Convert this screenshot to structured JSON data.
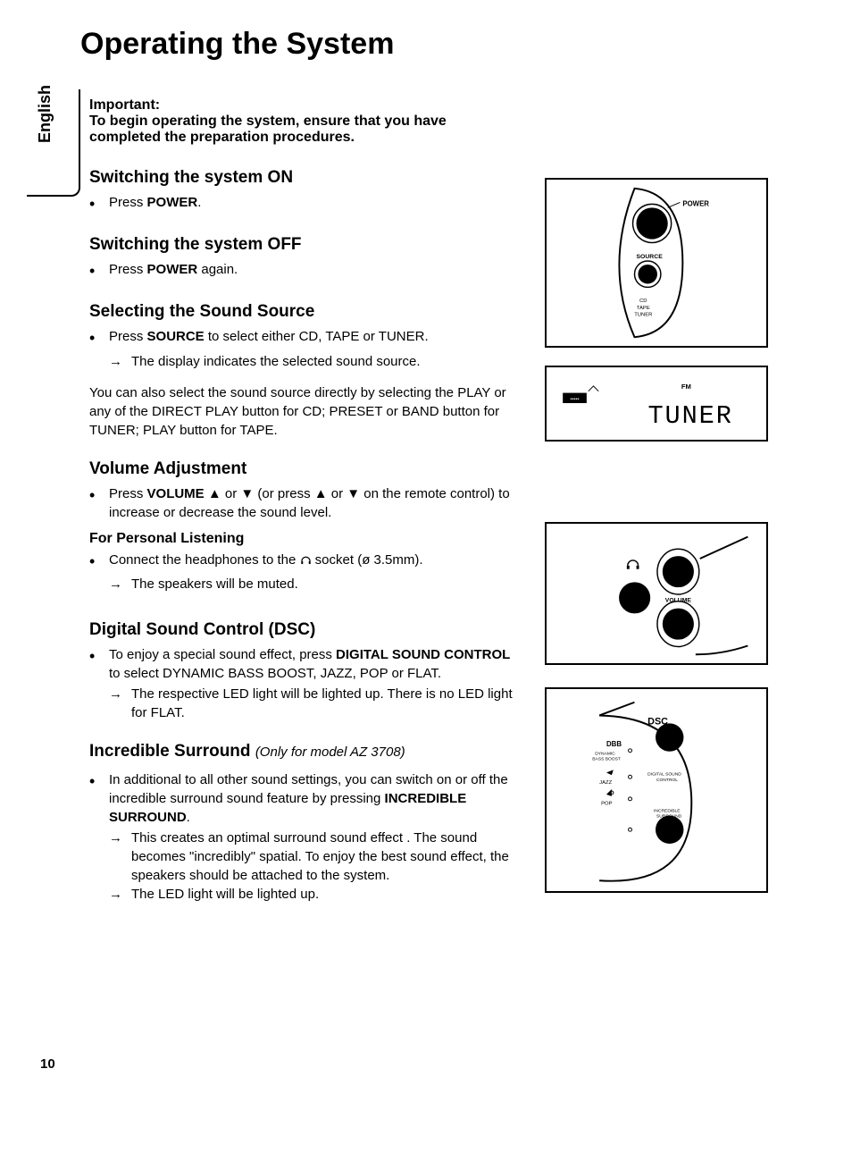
{
  "page_title": "Operating the System",
  "language_tab": "English",
  "intro": {
    "label": "Important:",
    "body": "To begin operating the system, ensure that you have completed the preparation procedures."
  },
  "sections": {
    "switch_on": {
      "heading": "Switching the system ON",
      "bullet1_pre": "Press ",
      "bullet1_bold": "POWER",
      "bullet1_post": "."
    },
    "switch_off": {
      "heading": "Switching the system OFF",
      "bullet1_pre": "Press ",
      "bullet1_bold": "POWER",
      "bullet1_post": " again."
    },
    "sound_source": {
      "heading": "Selecting the Sound Source",
      "bullet1_pre": "Press ",
      "bullet1_bold": "SOURCE",
      "bullet1_post": " to select either CD, TAPE or TUNER.",
      "arrow1": "The display indicates the selected sound source.",
      "para": "You can also select the sound source directly by selecting the PLAY or any of the DIRECT PLAY button for CD; PRESET or BAND button for TUNER; PLAY button for TAPE."
    },
    "volume": {
      "heading": "Volume Adjustment",
      "bullet1_pre": "Press ",
      "bullet1_bold": "VOLUME",
      "bullet1_mid": " ▲ or ▼ (or press ▲ or ▼ on the remote control) to increase or decrease the sound level.",
      "sub": "For Personal Listening",
      "bullet2_pre": "Connect the headphones to the ",
      "bullet2_icon": "♫",
      "bullet2_post": " socket (ø 3.5mm).",
      "arrow2": "The speakers will be muted."
    },
    "dsc": {
      "heading": "Digital Sound Control (DSC)",
      "bullet1_pre": "To enjoy a special sound effect, press ",
      "bullet1_bold": "DIGITAL SOUND CONTROL",
      "bullet1_post": " to select DYNAMIC BASS BOOST, JAZZ, POP or FLAT.",
      "arrow1": "The respective LED light will be lighted up. There is no LED light for FLAT."
    },
    "surround": {
      "heading": "Incredible Surround",
      "note": "(Only for model AZ 3708)",
      "bullet1_pre": "In additional to all other sound settings, you can switch on or off the incredible surround sound feature by pressing ",
      "bullet1_bold": "INCREDIBLE SURROUND",
      "bullet1_post": ".",
      "arrow1": "This creates an optimal surround sound effect . The sound becomes \"incredibly\" spatial. To enjoy the best sound effect, the speakers should be attached to the system.",
      "arrow2": "The LED light will be lighted up."
    }
  },
  "figures": {
    "power": {
      "power_label": "POWER",
      "source_label": "SOURCE",
      "list": "CD\nTAPE\nTUNER"
    },
    "display": {
      "fm": "FM",
      "seg": "TUNER"
    },
    "volume": {
      "label": "VOLUME",
      "hp_icon": "headphone-icon"
    },
    "dsc": {
      "dsc": "DSC",
      "dbb": "DBB",
      "dbb2": "DYNAMIC\nBASS BOOST",
      "jazz": "JAZZ",
      "pop": "POP",
      "ctrl": "DIGITAL SOUND\nCONTROL",
      "is": "INCREDIBLE\nSURROUND"
    }
  },
  "page_number": "10"
}
